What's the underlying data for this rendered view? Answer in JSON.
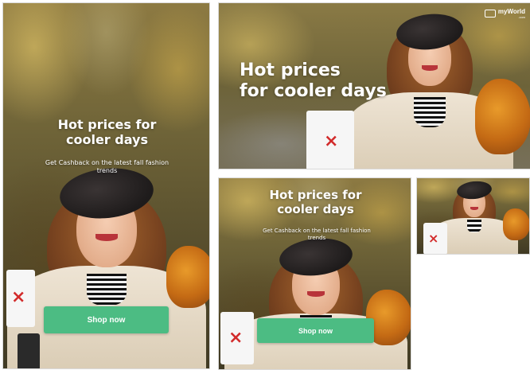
{
  "brand": {
    "logo_text": "myWorld",
    "logo_subtext": ".com"
  },
  "ad": {
    "headline": "Hot prices for cooler days",
    "headline_line1": "Hot prices for",
    "headline_line2": "cooler days",
    "headline_wide_line1": "Hot prices",
    "headline_wide_line2": "for cooler days",
    "subline": "Get Cashback on the latest fall fashion trends",
    "cta_label": "Shop now"
  },
  "colors": {
    "cta": "#4cbc83",
    "text": "#ffffff"
  },
  "banners": [
    {
      "name": "banner-tall",
      "has_text": true,
      "has_cta": true
    },
    {
      "name": "banner-wide",
      "has_text": true,
      "has_cta": false,
      "has_logo": true
    },
    {
      "name": "banner-square",
      "has_text": true,
      "has_cta": true
    },
    {
      "name": "banner-small",
      "has_text": false,
      "has_cta": false
    }
  ]
}
